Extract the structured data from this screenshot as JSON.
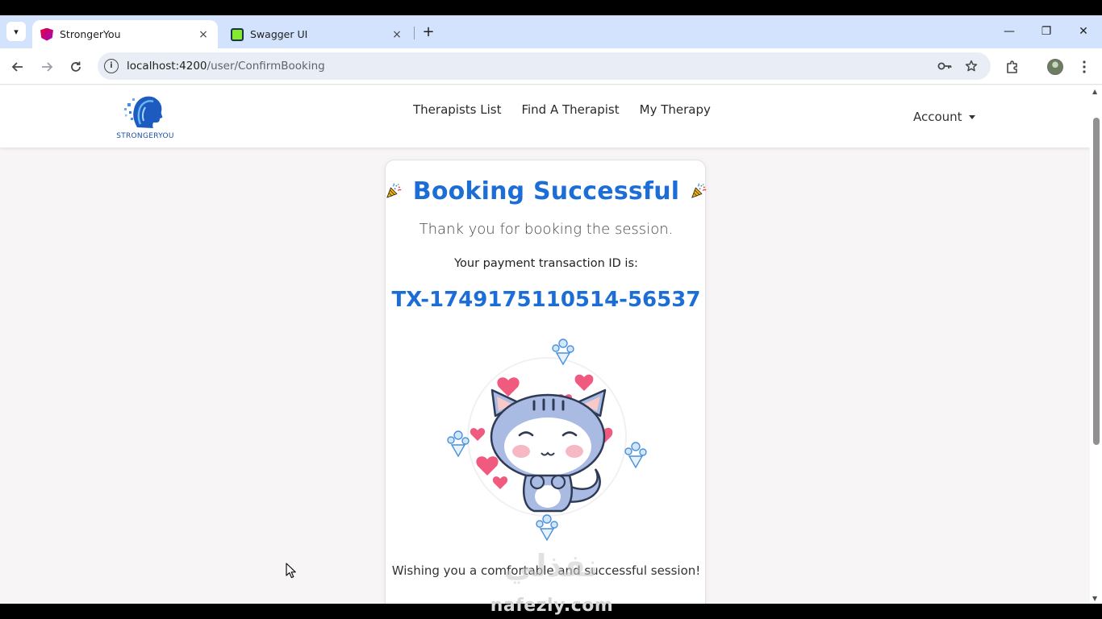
{
  "browser": {
    "tabs": [
      {
        "title": "StrongerYou",
        "active": true,
        "favicon": "angular-icon"
      },
      {
        "title": "Swagger UI",
        "active": false,
        "favicon": "swagger-icon"
      }
    ],
    "tab_close_glyph": "×",
    "new_tab_glyph": "+",
    "window": {
      "minimize": "—",
      "restore": "❐",
      "close": "✕"
    },
    "url": {
      "host": "localhost:4200",
      "path": "/user/ConfirmBooking"
    }
  },
  "site": {
    "logo_text": "STRONGERYOU",
    "nav": [
      "Therapists List",
      "Find A Therapist",
      "My Therapy"
    ],
    "account_label": "Account"
  },
  "booking": {
    "heading": "Booking Successful",
    "thanks": "Thank you for booking the session.",
    "tx_label": "Your payment transaction ID is:",
    "tx_id": "TX-1749175110514-56537",
    "wish": "Wishing you a comfortable and successful session!"
  },
  "watermark": {
    "arabic": "نفذلي",
    "latin": "nafezly.com"
  },
  "colors": {
    "accent": "#1c6ed6",
    "tabstrip": "#d3e3fd",
    "heart": "#f05a7e"
  }
}
